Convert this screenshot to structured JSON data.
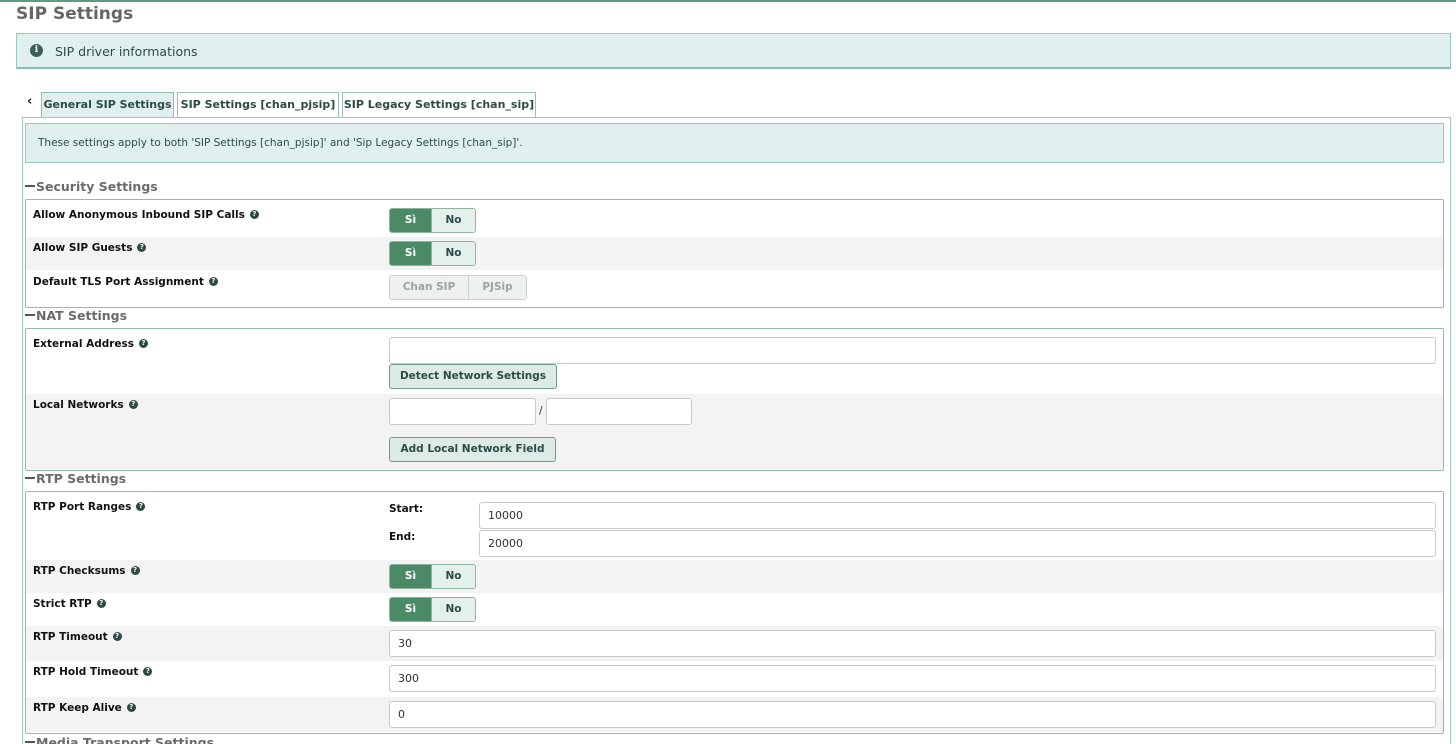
{
  "page": {
    "title": "SIP Settings"
  },
  "info": {
    "text": "SIP driver informations"
  },
  "tabs": [
    {
      "label": "General SIP Settings",
      "active": true
    },
    {
      "label": "SIP Settings [chan_pjsip]",
      "active": false
    },
    {
      "label": "SIP Legacy Settings [chan_sip]",
      "active": false
    }
  ],
  "note": "These settings apply to both 'SIP Settings [chan_pjsip]' and 'Sip Legacy Settings [chan_sip]'.",
  "sections": {
    "security": {
      "title": "Security Settings",
      "anon": {
        "label": "Allow Anonymous Inbound SIP Calls",
        "yes": "Sì",
        "no": "No",
        "value": "Sì"
      },
      "guests": {
        "label": "Allow SIP Guests",
        "yes": "Sì",
        "no": "No",
        "value": "Sì"
      },
      "tls": {
        "label": "Default TLS Port Assignment",
        "opt1": "Chan SIP",
        "opt2": "PJSip"
      }
    },
    "nat": {
      "title": "NAT Settings",
      "external": {
        "label": "External Address",
        "value": "",
        "button": "Detect Network Settings"
      },
      "local": {
        "label": "Local Networks",
        "separator": "/",
        "ip": "",
        "mask": "",
        "button": "Add Local Network Field"
      }
    },
    "rtp": {
      "title": "RTP Settings",
      "ports": {
        "label": "RTP Port Ranges",
        "start_label": "Start:",
        "start": "10000",
        "end_label": "End:",
        "end": "20000"
      },
      "checksums": {
        "label": "RTP Checksums",
        "yes": "Sì",
        "no": "No",
        "value": "Sì"
      },
      "strict": {
        "label": "Strict RTP",
        "yes": "Sì",
        "no": "No",
        "value": "Sì"
      },
      "timeout": {
        "label": "RTP Timeout",
        "value": "30"
      },
      "hold": {
        "label": "RTP Hold Timeout",
        "value": "300"
      },
      "keepalive": {
        "label": "RTP Keep Alive",
        "value": "0"
      }
    },
    "media": {
      "title": "Media Transport Settings"
    }
  },
  "help_glyph": "?",
  "info_glyph": "i",
  "collapse_glyph": "‹",
  "colors": {
    "accent": "#4b8a66",
    "info_bg": "#dff0ee",
    "border": "#8fbdb2"
  }
}
